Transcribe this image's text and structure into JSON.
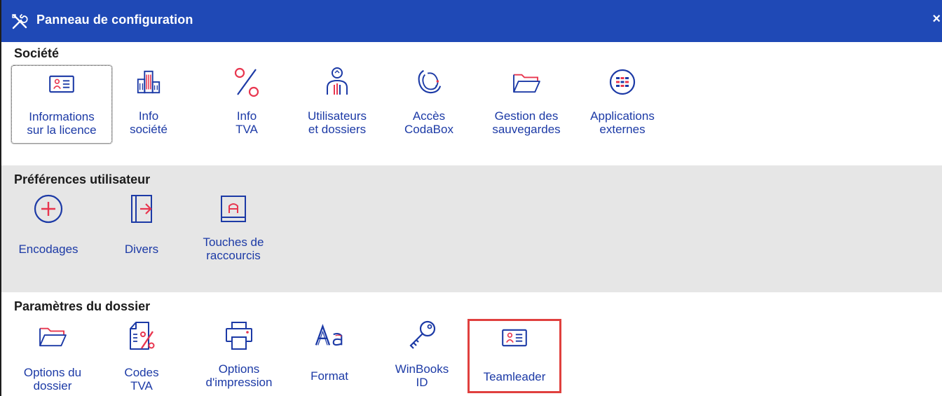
{
  "window": {
    "title": "Panneau de configuration",
    "close_glyph": "×"
  },
  "sections": {
    "societe": {
      "title": "Société",
      "items": [
        {
          "label": "Informations\nsur la licence",
          "icon": "id-card-icon"
        },
        {
          "label": "Info\nsociété",
          "icon": "building-icon"
        },
        {
          "label": "Info\nTVA",
          "icon": "percent-icon"
        },
        {
          "label": "Utilisateurs\net dossiers",
          "icon": "user-icon"
        },
        {
          "label": "Accès\nCodaBox",
          "icon": "codabox-icon"
        },
        {
          "label": "Gestion des\nsauvegardes",
          "icon": "folder-icon"
        },
        {
          "label": "Applications\nexternes",
          "icon": "apps-icon"
        }
      ]
    },
    "preferences": {
      "title": "Préférences utilisateur",
      "items": [
        {
          "label": "Encodages",
          "icon": "plus-circle-icon"
        },
        {
          "label": "Divers",
          "icon": "exit-door-icon"
        },
        {
          "label": "Touches de\nraccourcis",
          "icon": "keyboard-key-icon"
        }
      ]
    },
    "dossier": {
      "title": "Paramètres du dossier",
      "items": [
        {
          "label": "Options du\ndossier",
          "icon": "folder-icon"
        },
        {
          "label": "Codes\nTVA",
          "icon": "document-percent-icon"
        },
        {
          "label": "Options\nd'impression",
          "icon": "printer-icon"
        },
        {
          "label": "Format",
          "icon": "font-format-icon"
        },
        {
          "label": "WinBooks\nID",
          "icon": "key-icon"
        },
        {
          "label": "Teamleader",
          "icon": "id-card-icon"
        }
      ]
    }
  },
  "colors": {
    "titlebar": "#1f49b6",
    "icon_blue": "#1c3aa6",
    "icon_red": "#e8364f",
    "highlight": "#e0403e",
    "section_gray": "#e6e6e6"
  }
}
